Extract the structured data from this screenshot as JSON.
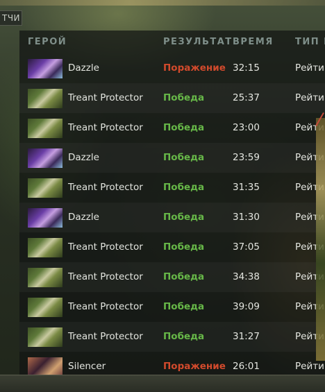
{
  "tab": {
    "label": "ТЧИ"
  },
  "columns": {
    "hero": "ГЕРОЙ",
    "result": "РЕЗУЛЬТАТ",
    "time": "ВРЕМЯ",
    "type": "ТИП И"
  },
  "matches": [
    {
      "hero": "Dazzle",
      "portrait": "dazzle",
      "result": "Поражение",
      "outcome": "loss",
      "time": "32:15",
      "type": "Рейтин"
    },
    {
      "hero": "Treant Protector",
      "portrait": "treant",
      "result": "Победа",
      "outcome": "win",
      "time": "25:37",
      "type": "Рейтин"
    },
    {
      "hero": "Treant Protector",
      "portrait": "treant",
      "result": "Победа",
      "outcome": "win",
      "time": "23:00",
      "type": "Рейтин"
    },
    {
      "hero": "Dazzle",
      "portrait": "dazzle",
      "result": "Победа",
      "outcome": "win",
      "time": "23:59",
      "type": "Рейтин"
    },
    {
      "hero": "Treant Protector",
      "portrait": "treant",
      "result": "Победа",
      "outcome": "win",
      "time": "31:35",
      "type": "Рейтин"
    },
    {
      "hero": "Dazzle",
      "portrait": "dazzle",
      "result": "Победа",
      "outcome": "win",
      "time": "31:30",
      "type": "Рейтин"
    },
    {
      "hero": "Treant Protector",
      "portrait": "treant",
      "result": "Победа",
      "outcome": "win",
      "time": "37:05",
      "type": "Рейтин"
    },
    {
      "hero": "Treant Protector",
      "portrait": "treant",
      "result": "Победа",
      "outcome": "win",
      "time": "34:38",
      "type": "Рейтин"
    },
    {
      "hero": "Treant Protector",
      "portrait": "treant",
      "result": "Победа",
      "outcome": "win",
      "time": "39:09",
      "type": "Рейтин"
    },
    {
      "hero": "Treant Protector",
      "portrait": "treant",
      "result": "Победа",
      "outcome": "win",
      "time": "31:27",
      "type": "Рейтин"
    },
    {
      "hero": "Silencer",
      "portrait": "silencer",
      "result": "Поражение",
      "outcome": "loss",
      "time": "26:01",
      "type": "Рейтин"
    }
  ],
  "colors": {
    "win": "#67b848",
    "loss": "#d24a2c",
    "header": "#7f8f8a"
  }
}
